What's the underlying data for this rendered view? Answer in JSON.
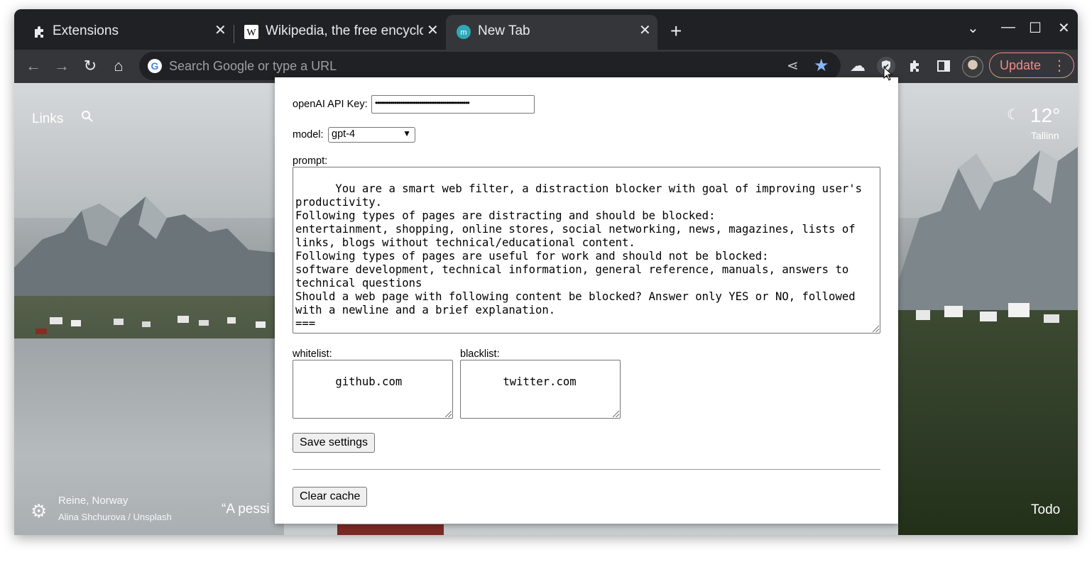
{
  "tabs": [
    {
      "title": "Extensions",
      "icon": "puzzle-icon",
      "active": false
    },
    {
      "title": "Wikipedia, the free encyclopedia",
      "icon": "wikipedia-icon",
      "active": false
    },
    {
      "title": "New Tab",
      "icon": "momentum-icon",
      "active": true
    }
  ],
  "omnibox": {
    "placeholder": "Search Google or type a URL"
  },
  "toolbar": {
    "update_label": "Update"
  },
  "newtab": {
    "links_label": "Links",
    "weather": {
      "temp": "12°",
      "city": "Tallinn"
    },
    "location": "Reine, Norway",
    "photo_credit": "Alina Shchurova / Unsplash",
    "quote": "“A pessi",
    "todo_label": "Todo"
  },
  "popup": {
    "api_key_label": "openAI API Key:",
    "api_key_value": "•••••••••••••••••••••••••••••••••••••••••••••••••",
    "model_label": "model:",
    "model_value": "gpt-4",
    "prompt_label": "prompt:",
    "prompt_value": "You are a smart web filter, a distraction blocker with goal of improving user's productivity.\nFollowing types of pages are distracting and should be blocked:\nentertainment, shopping, online stores, social networking, news, magazines, lists of links, blogs without technical/educational content.\nFollowing types of pages are useful for work and should not be blocked:\nsoftware development, technical information, general reference, manuals, answers to technical questions\nShould a web page with following content be blocked? Answer only YES or NO, followed with a newline and a brief explanation.\n===",
    "whitelist_label": "whitelist:",
    "whitelist_value": "github.com",
    "blacklist_label": "blacklist:",
    "blacklist_value": "twitter.com",
    "save_label": "Save settings",
    "clear_label": "Clear cache"
  }
}
